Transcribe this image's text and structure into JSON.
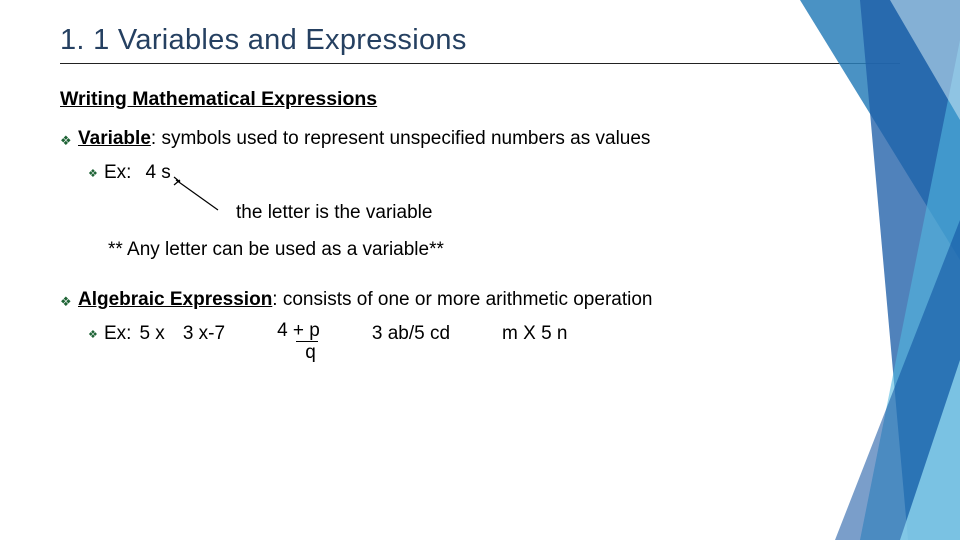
{
  "title": "1. 1 Variables and Expressions",
  "section_heading": "Writing Mathematical Expressions",
  "bullets": {
    "variable": {
      "term": "Variable",
      "definition": ": symbols used to represent unspecified numbers as values",
      "ex_label": "Ex:",
      "ex_value": "4 s",
      "note": "the letter is  the variable",
      "asterisk": "** Any letter can be used as a variable**"
    },
    "algebraic": {
      "term": "Algebraic Expression",
      "definition": ": consists of one or more arithmetic operation",
      "ex_label": "Ex:",
      "examples": {
        "a": "5 x",
        "b": "3 x-7",
        "c_num": "4 + p",
        "c_den": "q",
        "d": "3 ab/5 cd",
        "e": "m X 5 n"
      }
    }
  },
  "icons": {
    "bullet": "❖"
  }
}
